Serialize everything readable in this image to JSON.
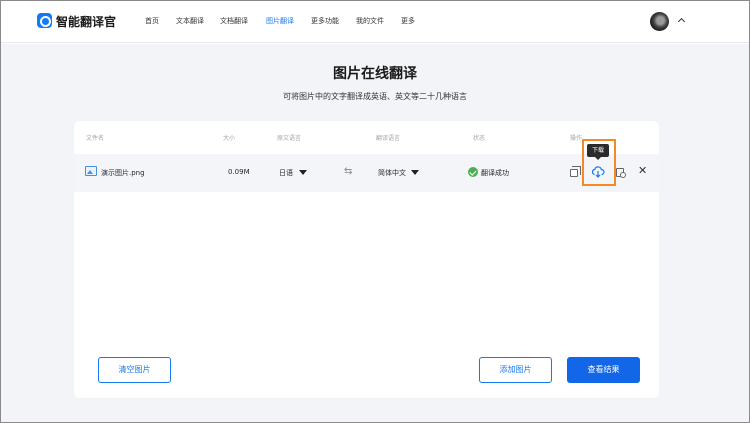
{
  "app": {
    "name": "智能翻译官"
  },
  "nav": {
    "items": [
      {
        "label": "首页",
        "active": false
      },
      {
        "label": "文本翻译",
        "active": false
      },
      {
        "label": "文档翻译",
        "active": false
      },
      {
        "label": "图片翻译",
        "active": true
      },
      {
        "label": "更多功能",
        "active": false
      },
      {
        "label": "我的文件",
        "active": false
      },
      {
        "label": "更多",
        "active": false
      }
    ]
  },
  "page": {
    "title": "图片在线翻译",
    "subtitle": "可将图片中的文字翻译成英语、英文等二十几种语言"
  },
  "table": {
    "headers": {
      "filename": "文件名",
      "size": "大小",
      "source_lang": "原文语言",
      "target_lang": "翻译语言",
      "status": "状态",
      "actions": "操作"
    },
    "rows": [
      {
        "filename": "演示图片.png",
        "size": "0.09M",
        "source_lang": "日语",
        "target_lang": "简体中文",
        "status": "翻译成功"
      }
    ]
  },
  "tooltip": {
    "download": "下载"
  },
  "buttons": {
    "clear": "清空图片",
    "add": "添加图片",
    "view": "查看结果"
  },
  "colors": {
    "accent": "#1479f2",
    "primary_button": "#1267e8",
    "success": "#4caf50",
    "highlight": "#f28a2c"
  },
  "icons": {
    "logo": "app-logo-icon",
    "file": "image-file-icon",
    "swap": "swap-arrows-icon",
    "status": "check-circle-icon",
    "copy": "copy-icon",
    "download": "cloud-download-icon",
    "preview": "preview-icon",
    "delete": "close-icon",
    "account": "chevron-up-icon"
  }
}
